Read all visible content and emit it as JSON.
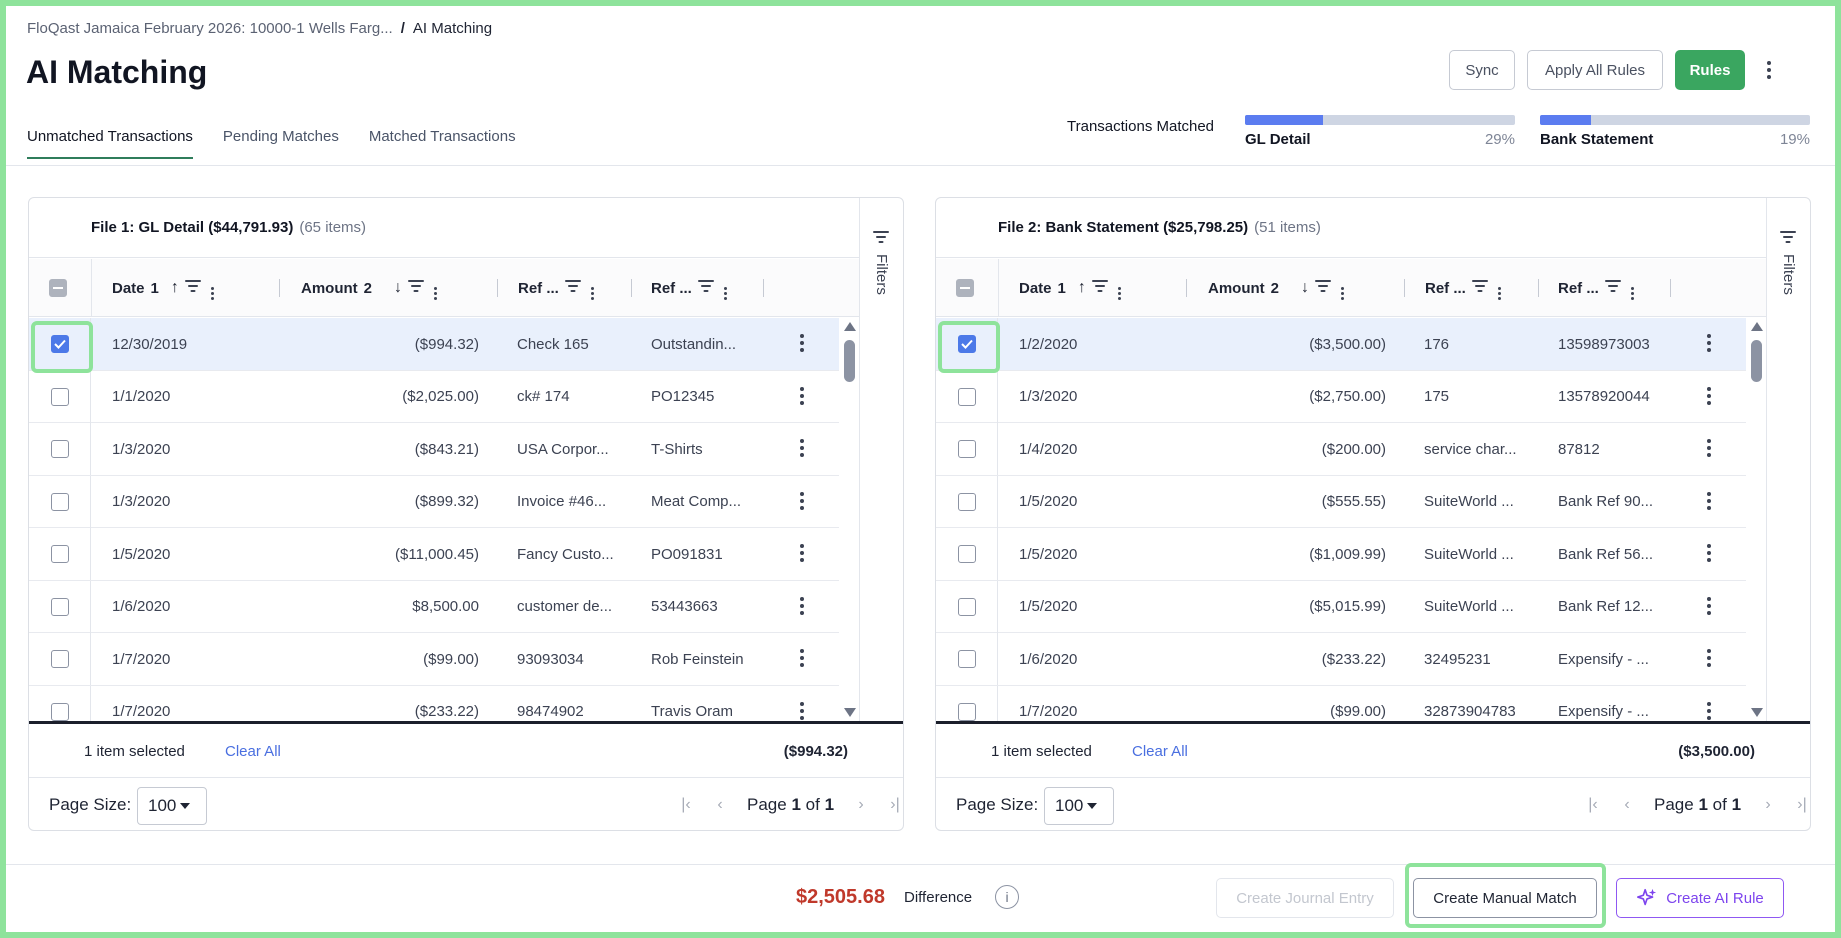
{
  "breadcrumb": {
    "parent": "FloQast Jamaica February 2026: 10000-1 Wells Farg...",
    "separator": "/",
    "current": "AI Matching"
  },
  "page_title": "AI Matching",
  "header_buttons": {
    "sync": "Sync",
    "apply_all_rules": "Apply All Rules",
    "rules": "Rules"
  },
  "tabs": [
    {
      "label": "Unmatched Transactions",
      "active": true
    },
    {
      "label": "Pending Matches",
      "active": false
    },
    {
      "label": "Matched Transactions",
      "active": false
    }
  ],
  "progress": {
    "label": "Transactions Matched",
    "gl": {
      "name": "GL Detail",
      "pct_label": "29%",
      "fraction": 0.29
    },
    "bank": {
      "name": "Bank Statement",
      "pct_label": "19%",
      "fraction": 0.19
    }
  },
  "colors": {
    "accent_green": "#3aa660",
    "highlight": "#8ee39b",
    "link_blue": "#4a6fe0",
    "difference_red": "#c0392b",
    "ai_purple": "#7d44ee"
  },
  "filters_label": "Filters",
  "columns": {
    "date": "Date",
    "date_sort": "1",
    "amount": "Amount",
    "amount_sort": "2",
    "ref1": "Ref ...",
    "ref2": "Ref ..."
  },
  "panels": [
    {
      "title": "File 1: GL Detail",
      "total": "($44,791.93)",
      "count": "(65 items)",
      "rows": [
        {
          "date": "12/30/2019",
          "amount": "($994.32)",
          "ref1": "Check 165",
          "ref2": "Outstandin...",
          "checked": true
        },
        {
          "date": "1/1/2020",
          "amount": "($2,025.00)",
          "ref1": "ck# 174",
          "ref2": "PO12345",
          "checked": false
        },
        {
          "date": "1/3/2020",
          "amount": "($843.21)",
          "ref1": "USA Corpor...",
          "ref2": "T-Shirts",
          "checked": false
        },
        {
          "date": "1/3/2020",
          "amount": "($899.32)",
          "ref1": "Invoice #46...",
          "ref2": "Meat Comp...",
          "checked": false
        },
        {
          "date": "1/5/2020",
          "amount": "($11,000.45)",
          "ref1": "Fancy Custo...",
          "ref2": "PO091831",
          "checked": false
        },
        {
          "date": "1/6/2020",
          "amount": "$8,500.00",
          "ref1": "customer de...",
          "ref2": "53443663",
          "checked": false
        },
        {
          "date": "1/7/2020",
          "amount": "($99.00)",
          "ref1": "93093034",
          "ref2": "Rob Feinstein",
          "checked": false
        },
        {
          "date": "1/7/2020",
          "amount": "($233.22)",
          "ref1": "98474902",
          "ref2": "Travis Oram",
          "checked": false
        }
      ],
      "selection": {
        "count_text": "1 item selected",
        "clear": "Clear All",
        "amount": "($994.32)"
      },
      "pager": {
        "page_size_label": "Page Size:",
        "page_size": "100",
        "page_word": "Page",
        "page": "1",
        "of_word": "of",
        "total_pages": "1"
      }
    },
    {
      "title": "File 2: Bank Statement",
      "total": "($25,798.25)",
      "count": "(51 items)",
      "rows": [
        {
          "date": "1/2/2020",
          "amount": "($3,500.00)",
          "ref1": "176",
          "ref2": "13598973003",
          "checked": true
        },
        {
          "date": "1/3/2020",
          "amount": "($2,750.00)",
          "ref1": "175",
          "ref2": "13578920044",
          "checked": false
        },
        {
          "date": "1/4/2020",
          "amount": "($200.00)",
          "ref1": "service char...",
          "ref2": "87812",
          "checked": false
        },
        {
          "date": "1/5/2020",
          "amount": "($555.55)",
          "ref1": "SuiteWorld ...",
          "ref2": "Bank Ref 90...",
          "checked": false
        },
        {
          "date": "1/5/2020",
          "amount": "($1,009.99)",
          "ref1": "SuiteWorld ...",
          "ref2": "Bank Ref 56...",
          "checked": false
        },
        {
          "date": "1/5/2020",
          "amount": "($5,015.99)",
          "ref1": "SuiteWorld ...",
          "ref2": "Bank Ref 12...",
          "checked": false
        },
        {
          "date": "1/6/2020",
          "amount": "($233.22)",
          "ref1": "32495231",
          "ref2": "Expensify - ...",
          "checked": false
        },
        {
          "date": "1/7/2020",
          "amount": "($99.00)",
          "ref1": "32873904783",
          "ref2": "Expensify - ...",
          "checked": false
        }
      ],
      "selection": {
        "count_text": "1 item selected",
        "clear": "Clear All",
        "amount": "($3,500.00)"
      },
      "pager": {
        "page_size_label": "Page Size:",
        "page_size": "100",
        "page_word": "Page",
        "page": "1",
        "of_word": "of",
        "total_pages": "1"
      }
    }
  ],
  "footer": {
    "difference_amount": "$2,505.68",
    "difference_label": "Difference",
    "info_glyph": "i",
    "create_journal_entry": "Create Journal Entry",
    "create_manual_match": "Create Manual Match",
    "create_ai_rule": "Create AI Rule"
  }
}
